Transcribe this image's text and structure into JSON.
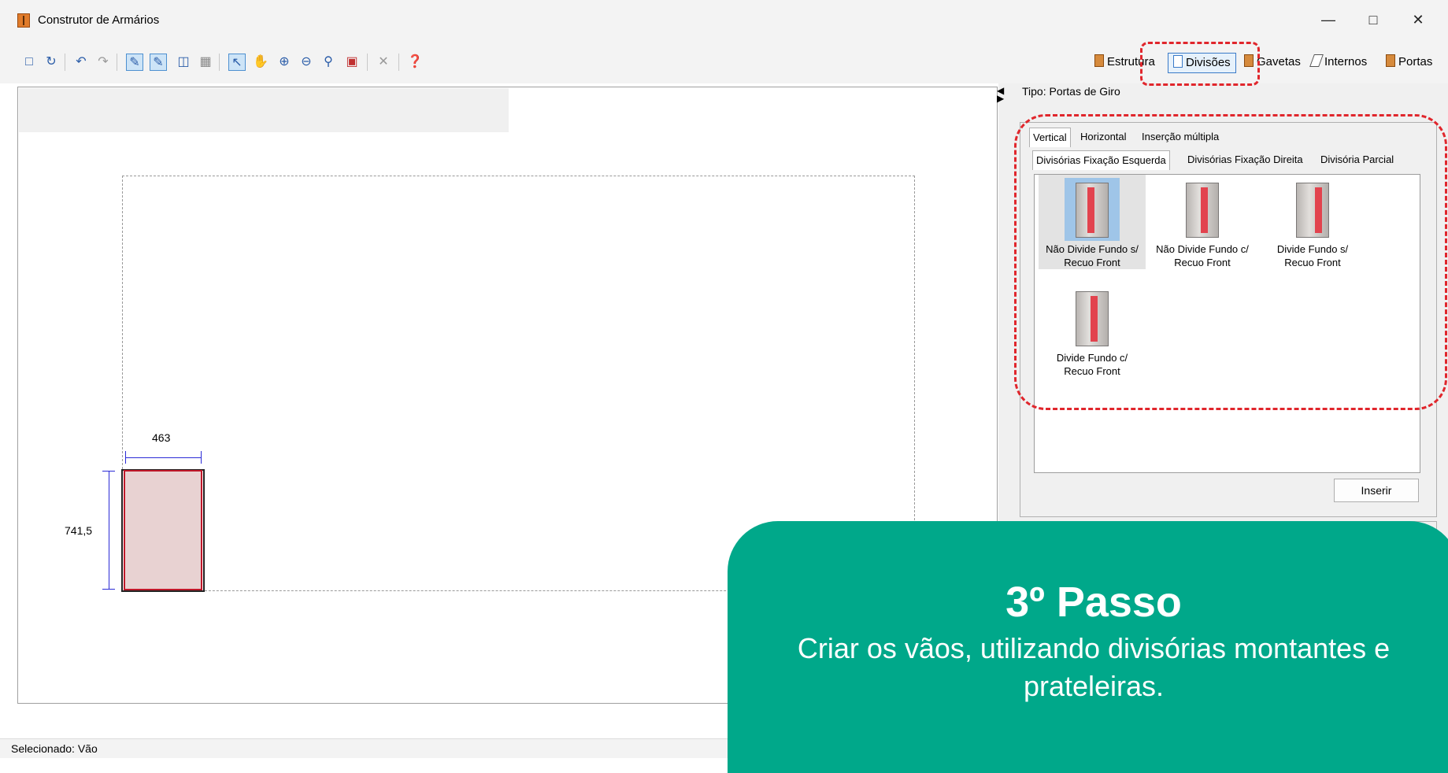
{
  "window": {
    "title": "Construtor de Armários",
    "controls": [
      "minimize",
      "maximize",
      "close"
    ]
  },
  "toolbar": {
    "icons": [
      "new-icon",
      "refresh-icon",
      "undo-icon",
      "redo-icon",
      "select-mode-icon",
      "edit-mode-icon",
      "module-icon",
      "grid-icon",
      "pointer-icon",
      "pan-icon",
      "zoom-extents-icon",
      "zoom-out-icon",
      "zoom-in-icon",
      "window-icon",
      "delete-icon",
      "help-icon"
    ],
    "tabs": [
      {
        "label": "Estrutura",
        "icon": "cabinet-icon"
      },
      {
        "label": "Divisões",
        "icon": "grid-icon",
        "selected": true
      },
      {
        "label": "Gavetas",
        "icon": "drawer-icon"
      },
      {
        "label": "Internos",
        "icon": "shelf-icon"
      },
      {
        "label": "Portas",
        "icon": "door-icon"
      }
    ]
  },
  "canvas": {
    "dim_width": "463",
    "dim_height": "741,5"
  },
  "panel": {
    "tipo": "Tipo: Portas de Giro",
    "tabs": [
      "Vertical",
      "Horizontal",
      "Inserção múltipla"
    ],
    "subtabs": [
      "Divisórias Fixação Esquerda",
      "Divisórias Fixação Direita",
      "Divisória Parcial"
    ],
    "items": [
      {
        "line1": "Não Divide Fundo s/",
        "line2": "Recuo Front",
        "selected": true
      },
      {
        "line1": "Não Divide Fundo c/",
        "line2": "Recuo Front"
      },
      {
        "line1": "Divide Fundo s/",
        "line2": "Recuo Front"
      },
      {
        "line1": "Divide Fundo c/",
        "line2": "Recuo Front"
      }
    ],
    "insert_label": "Inserir"
  },
  "status": "Selecionado: Vão",
  "overlay": {
    "title": "3º Passo",
    "text": "Criar os vãos, utilizando divisórias montantes e prateleiras.",
    "color": "#00a88a"
  },
  "colors": {
    "highlight": "#e0262c",
    "accent": "#3a7ac8",
    "cabinet_edge": "#c0182a",
    "dimension": "#2b2bd6"
  }
}
